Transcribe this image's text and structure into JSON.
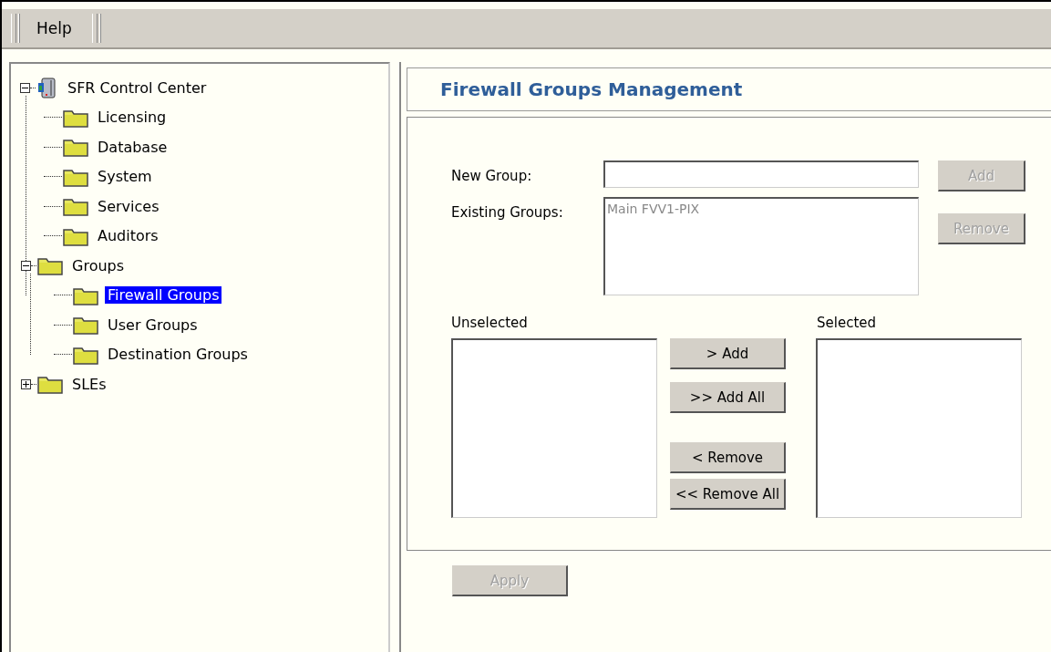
{
  "menu": [
    {
      "label": "Help"
    }
  ],
  "tree": [
    {
      "label": "SFR Control Center",
      "kind": "root",
      "expanded": true,
      "selected": false,
      "children": [
        {
          "label": "Licensing",
          "kind": "leaf",
          "selected": false
        },
        {
          "label": "Database",
          "kind": "leaf",
          "selected": false
        },
        {
          "label": "System",
          "kind": "leaf",
          "selected": false
        },
        {
          "label": "Services",
          "kind": "leaf",
          "selected": false
        },
        {
          "label": "Auditors",
          "kind": "leaf",
          "selected": false
        },
        {
          "label": "Groups",
          "kind": "branch",
          "expanded": true,
          "selected": false,
          "children": [
            {
              "label": "Firewall Groups",
              "kind": "leaf",
              "selected": true
            },
            {
              "label": "User Groups",
              "kind": "leaf",
              "selected": false
            },
            {
              "label": "Destination Groups",
              "kind": "leaf",
              "selected": false
            }
          ]
        },
        {
          "label": "SLEs",
          "kind": "branch",
          "expanded": false,
          "selected": false
        }
      ]
    }
  ],
  "page_title": "Firewall Groups Management",
  "form": {
    "new_group": {
      "label": "New Group:"
    },
    "add_button": {
      "label": "Add",
      "disabled": true
    },
    "existing_groups": {
      "label": "Existing Groups:",
      "items": [
        "Main FVV1-PIX"
      ]
    },
    "remove_button": {
      "label": "Remove",
      "disabled": true
    },
    "unselected": {
      "label": "Unselected"
    },
    "selected": {
      "label": "Selected"
    },
    "move_buttons": [
      {
        "label": "> Add",
        "disabled": false
      },
      {
        "label": ">> Add All",
        "disabled": false
      },
      {
        "label": "< Remove",
        "disabled": false
      },
      {
        "label": "<< Remove All",
        "disabled": false
      }
    ]
  },
  "apply_button": {
    "label": "Apply",
    "disabled": true
  }
}
